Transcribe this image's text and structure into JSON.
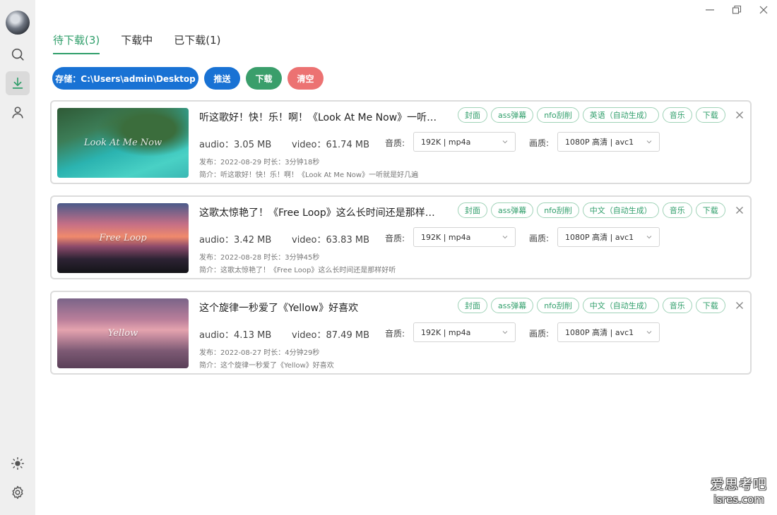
{
  "window": {
    "controls": [
      "minimize-icon",
      "restore-icon",
      "close-icon"
    ]
  },
  "sidebar": {
    "items": [
      {
        "icon": "search-icon"
      },
      {
        "icon": "download-icon",
        "active": true
      },
      {
        "icon": "user-icon"
      }
    ],
    "bottom": [
      {
        "icon": "theme-sun-icon"
      },
      {
        "icon": "gear-icon"
      }
    ]
  },
  "tabs": [
    {
      "label": "待下载(3)",
      "active": true
    },
    {
      "label": "下载中"
    },
    {
      "label": "已下载(1)"
    }
  ],
  "toolbar": {
    "storage_label": "存储：C:\\Users\\admin\\Desktop",
    "push_label": "推送",
    "download_label": "下载",
    "clear_label": "清空"
  },
  "labels": {
    "quality": "音质:",
    "resolution": "画质:"
  },
  "items": [
    {
      "title": "听这歌好！快！乐！啊！《Look At Me Now》一听…",
      "thumb_text": "Look At Me Now",
      "tags": [
        "封面",
        "ass弹幕",
        "nfo刮削",
        "英语（自动生成）",
        "音乐",
        "下载"
      ],
      "audio": "audio：3.05 MB",
      "video": "video：61.74 MB",
      "audio_quality": "192K | mp4a",
      "video_quality": "1080P 高清 | avc1",
      "published": "发布：2022-08-29 时长：3分钟18秒",
      "intro": "简介：听这歌好！快！乐！啊！《Look At Me Now》一听就是好几遍"
    },
    {
      "title": "这歌太惊艳了！《Free Loop》这么长时间还是那样…",
      "thumb_text": "Free Loop",
      "tags": [
        "封面",
        "ass弹幕",
        "nfo刮削",
        "中文（自动生成）",
        "音乐",
        "下载"
      ],
      "audio": "audio：3.42 MB",
      "video": "video：63.83 MB",
      "audio_quality": "192K | mp4a",
      "video_quality": "1080P 高清 | avc1",
      "published": "发布：2022-08-28 时长：3分钟45秒",
      "intro": "简介：这歌太惊艳了！《Free Loop》这么长时间还是那样好听"
    },
    {
      "title": "这个旋律一秒爱了《Yellow》好喜欢",
      "thumb_text": "Yellow",
      "tags": [
        "封面",
        "ass弹幕",
        "nfo刮削",
        "中文（自动生成）",
        "音乐",
        "下载"
      ],
      "audio": "audio：4.13 MB",
      "video": "video：87.49 MB",
      "audio_quality": "192K | mp4a",
      "video_quality": "1080P 高清 | avc1",
      "published": "发布：2022-08-27 时长：4分钟29秒",
      "intro": "简介：这个旋律一秒爱了《Yellow》好喜欢"
    }
  ],
  "watermark": {
    "line1": "爱思考吧",
    "line2": "isres.com"
  },
  "colors": {
    "accent_green": "#2f9e6a",
    "button_blue": "#1972d4",
    "button_red": "#ec7272"
  }
}
